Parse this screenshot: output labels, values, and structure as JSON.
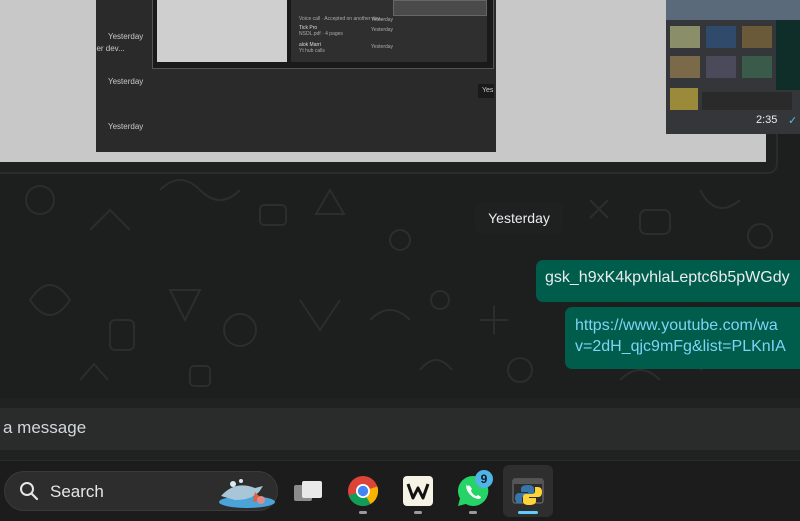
{
  "preview_image": {
    "timestamps": [
      "Yesterday",
      "Yesterday",
      "Yesterday"
    ],
    "fragment_text": "her dev...",
    "inner_list": [
      {
        "name": "",
        "sub": "Voice call · Accepted on another dev...",
        "time": "Yesterday"
      },
      {
        "name": "Tick Pro",
        "sub": "NSDL.pdf · 4 pages",
        "time": "Yesterday"
      },
      {
        "name": "alok Marri",
        "sub": "Yt hub calls",
        "time": "Yesterday"
      }
    ],
    "corner_pill": "Yes",
    "time": "2:35",
    "tick": "✓"
  },
  "date_divider": "Yesterday",
  "messages": [
    {
      "text": "gsk_h9xK4kpvhlaLeptc6b5pWGdy"
    },
    {
      "line1": "https://www.youtube.com/wa",
      "line2": "v=2dH_qjc9mFg&list=PLKnIA"
    }
  ],
  "composer": {
    "placeholder": "a message"
  },
  "taskbar": {
    "search_label": "Search",
    "whatsapp_badge": "9"
  },
  "colors": {
    "outgoing_bubble": "#005c4b",
    "link": "#7fd3f5",
    "badge": "#4fb4e8"
  }
}
